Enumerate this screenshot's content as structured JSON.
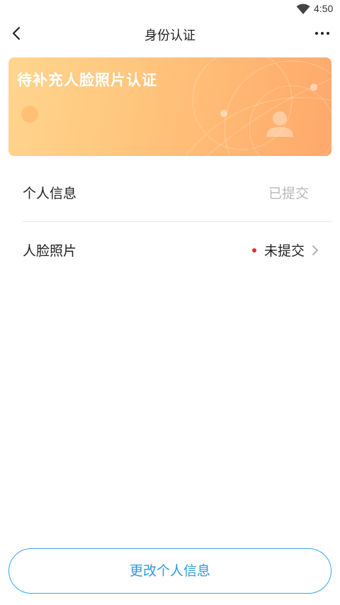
{
  "status_bar": {
    "time": "4:50"
  },
  "header": {
    "title": "身份认证"
  },
  "banner": {
    "title": "待补充人脸照片认证"
  },
  "rows": [
    {
      "label": "个人信息",
      "status": "已提交"
    },
    {
      "label": "人脸照片",
      "status": "未提交"
    }
  ],
  "footer": {
    "button_label": "更改个人信息"
  },
  "colors": {
    "accent": "#2c9be0",
    "banner_start": "#ffd58f",
    "banner_end": "#ffa86a",
    "alert_dot": "#e0302c",
    "submitted_gray": "#b8b8b8"
  },
  "icons": [
    "wifi-icon",
    "back-arrow-icon",
    "more-icon",
    "chevron-right-icon",
    "user-silhouette-icon"
  ]
}
